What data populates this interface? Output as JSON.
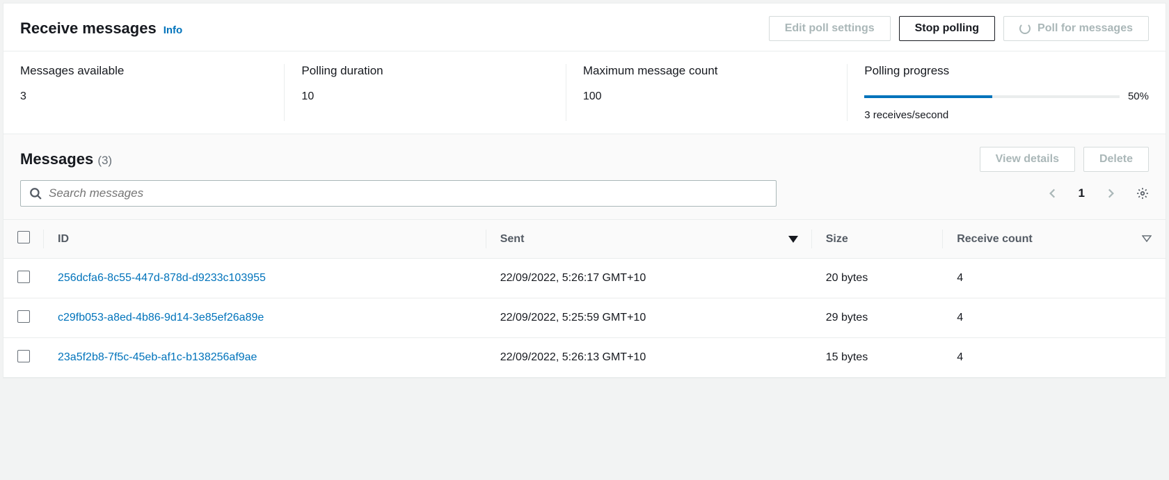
{
  "header": {
    "title": "Receive messages",
    "info": "Info",
    "buttons": {
      "edit": "Edit poll settings",
      "stop": "Stop polling",
      "poll": "Poll for messages"
    }
  },
  "stats": {
    "available_label": "Messages available",
    "available_value": "3",
    "duration_label": "Polling duration",
    "duration_value": "10",
    "max_label": "Maximum message count",
    "max_value": "100",
    "progress_label": "Polling progress",
    "progress_pct_text": "50%",
    "progress_pct_num": 50,
    "progress_rate": "3 receives/second"
  },
  "messages": {
    "title": "Messages",
    "count": "(3)",
    "buttons": {
      "view": "View details",
      "delete": "Delete"
    },
    "search_placeholder": "Search messages",
    "page": "1",
    "columns": {
      "id": "ID",
      "sent": "Sent",
      "size": "Size",
      "receive": "Receive count"
    },
    "rows": [
      {
        "id": "256dcfa6-8c55-447d-878d-d9233c103955",
        "sent": "22/09/2022, 5:26:17 GMT+10",
        "size": "20 bytes",
        "receive": "4"
      },
      {
        "id": "c29fb053-a8ed-4b86-9d14-3e85ef26a89e",
        "sent": "22/09/2022, 5:25:59 GMT+10",
        "size": "29 bytes",
        "receive": "4"
      },
      {
        "id": "23a5f2b8-7f5c-45eb-af1c-b138256af9ae",
        "sent": "22/09/2022, 5:26:13 GMT+10",
        "size": "15 bytes",
        "receive": "4"
      }
    ]
  }
}
